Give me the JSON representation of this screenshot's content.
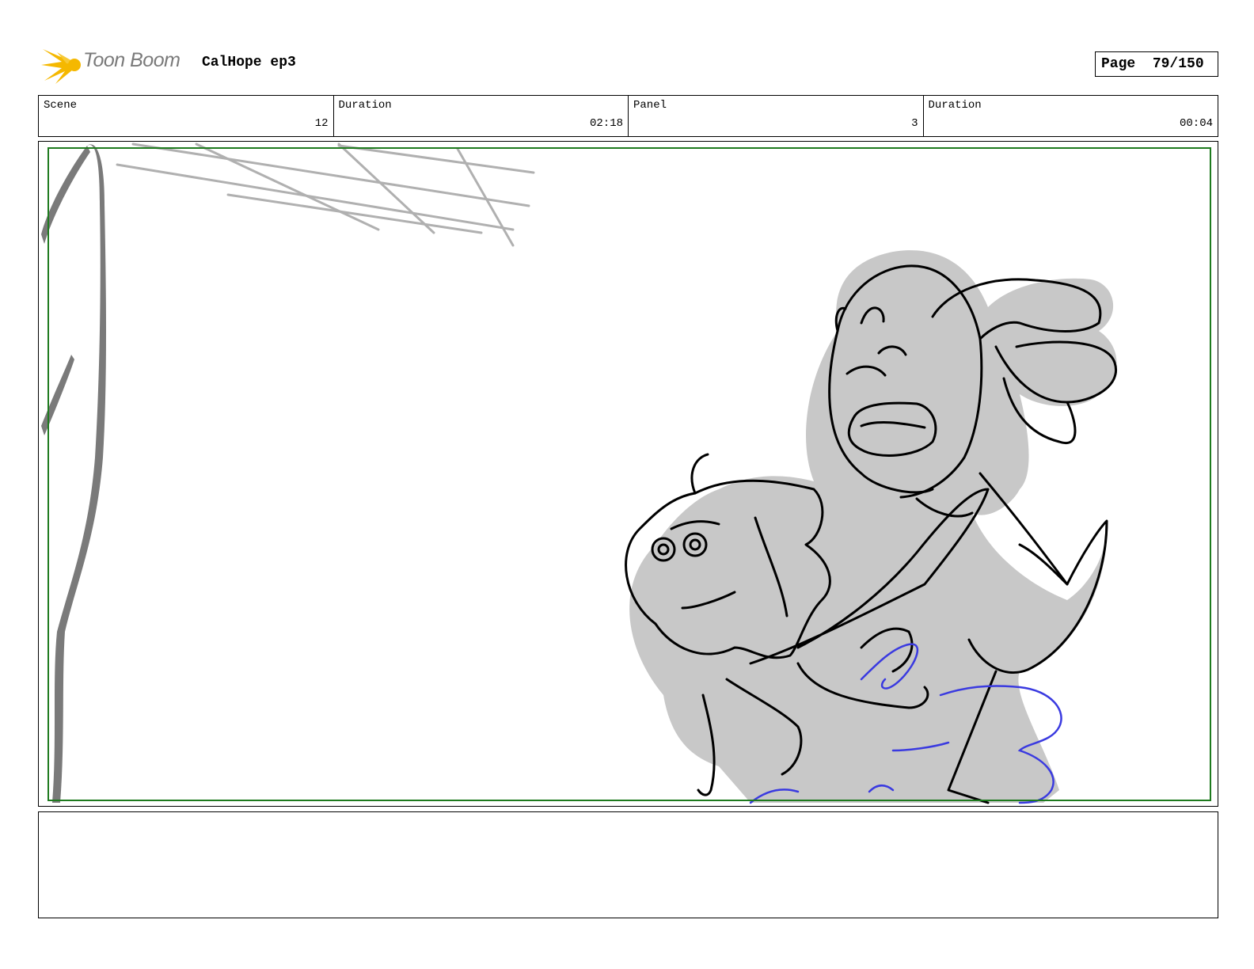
{
  "header": {
    "logo_text": "Toon Boom",
    "project_title": "CalHope ep3",
    "page_label": "Page",
    "page_number": "79/150"
  },
  "info": {
    "scene_label": "Scene",
    "scene_value": "12",
    "scene_duration_label": "Duration",
    "scene_duration_value": "02:18",
    "panel_label": "Panel",
    "panel_value": "3",
    "panel_duration_label": "Duration",
    "panel_duration_value": "00:04"
  },
  "colors": {
    "safe_area": "#1e7a1e",
    "sketch_fill": "#c8c8c8",
    "sketch_line": "#000000",
    "guide_line": "#3a3ae0",
    "logo_star": "#f5b800"
  },
  "notes": {
    "text": ""
  }
}
